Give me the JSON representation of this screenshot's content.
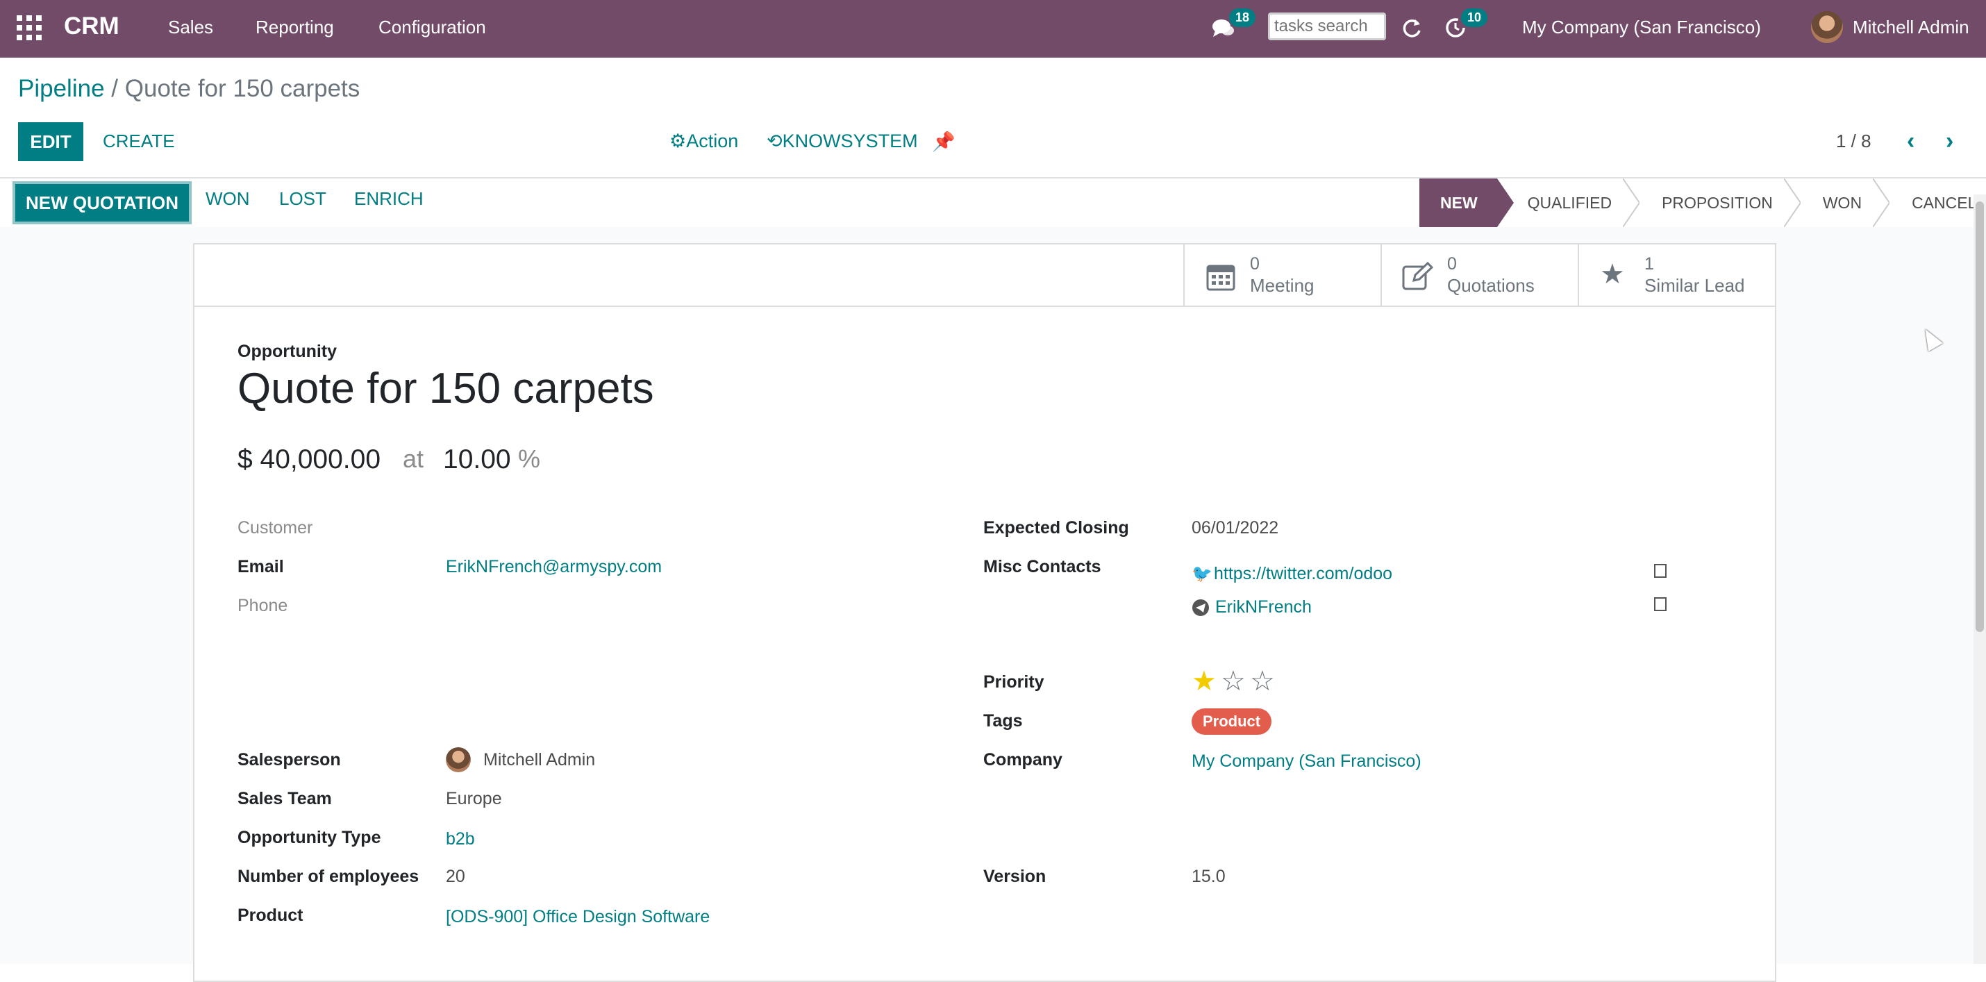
{
  "topnav": {
    "brand": "CRM",
    "menu": [
      "Sales",
      "Reporting",
      "Configuration"
    ],
    "messages_badge": "18",
    "activities_badge": "10",
    "search_placeholder": "tasks search",
    "company": "My Company (San Francisco)",
    "user": "Mitchell Admin"
  },
  "breadcrumb": {
    "parent": "Pipeline",
    "separator": "/",
    "current": "Quote for 150 carpets"
  },
  "control": {
    "edit": "EDIT",
    "create": "CREATE",
    "action": "Action",
    "knowsystem": "KNOWSYSTEM",
    "pager": "1 / 8"
  },
  "statusbar": {
    "buttons": [
      "NEW QUOTATION",
      "WON",
      "LOST",
      "ENRICH"
    ],
    "stages": [
      "NEW",
      "QUALIFIED",
      "PROPOSITION",
      "WON",
      "CANCELLED"
    ],
    "active_stage": "NEW"
  },
  "smart_buttons": [
    {
      "value": "0",
      "label": "Meeting",
      "icon": "calendar-icon"
    },
    {
      "value": "0",
      "label": "Quotations",
      "icon": "edit-icon"
    },
    {
      "value": "1",
      "label": "Similar Lead",
      "icon": "star-icon"
    }
  ],
  "form": {
    "type_label": "Opportunity",
    "name": "Quote for 150 carpets",
    "revenue": "$ 40,000.00",
    "at": "at",
    "probability": "10.00",
    "percent": "%",
    "left": {
      "customer_label": "Customer",
      "email_label": "Email",
      "email": "ErikNFrench@armyspy.com",
      "phone_label": "Phone",
      "salesperson_label": "Salesperson",
      "salesperson": "Mitchell Admin",
      "team_label": "Sales Team",
      "team": "Europe",
      "opp_type_label": "Opportunity Type",
      "opp_type": "b2b",
      "employees_label": "Number of employees",
      "employees": "20",
      "product_label": "Product",
      "product": "[ODS-900] Office Design Software"
    },
    "right": {
      "closing_label": "Expected Closing",
      "closing": "06/01/2022",
      "misc_label": "Misc Contacts",
      "twitter": "https://twitter.com/odoo",
      "telegram": "ErikNFrench",
      "priority_label": "Priority",
      "priority": 1,
      "priority_max": 3,
      "tags_label": "Tags",
      "tag": "Product",
      "company_label": "Company",
      "company": "My Company (San Francisco)",
      "version_label": "Version",
      "version": "15.0"
    }
  },
  "colors": {
    "brand": "#714b67",
    "primary": "#017e84",
    "tag": "#e35d4c",
    "star": "#f3cc00"
  }
}
